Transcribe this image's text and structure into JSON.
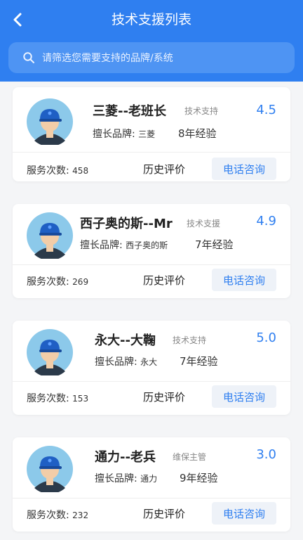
{
  "header": {
    "title": "技术支援列表",
    "search_placeholder": "请筛选您需要支持的品牌/系统"
  },
  "colors": {
    "accent": "#2f7ff0",
    "header_bg": "#2f7ff0"
  },
  "icons": {
    "back": "chevron-left-icon",
    "search": "search-icon",
    "avatar": "technician-avatar-icon"
  },
  "technicians": [
    {
      "name": "三菱--老班长",
      "role": "技术支持",
      "rating": "4.5",
      "brand_label": "擅长品牌:",
      "brand": "三菱",
      "experience": "8年经验",
      "count_label": "服务次数:",
      "count": "458",
      "history_label": "历史评价",
      "call_label": "电话咨询"
    },
    {
      "name": "西子奥的斯--Mr",
      "role": "技术支援",
      "rating": "4.9",
      "brand_label": "擅长品牌:",
      "brand": "西子奥的斯",
      "experience": "7年经验",
      "count_label": "服务次数:",
      "count": "269",
      "history_label": "历史评价",
      "call_label": "电话咨询"
    },
    {
      "name": "永大--大鞠",
      "role": "技术支持",
      "rating": "5.0",
      "brand_label": "擅长品牌:",
      "brand": "永大",
      "experience": "7年经验",
      "count_label": "服务次数:",
      "count": "153",
      "history_label": "历史评价",
      "call_label": "电话咨询"
    },
    {
      "name": "通力--老兵",
      "role": "维保主管",
      "rating": "3.0",
      "brand_label": "擅长品牌:",
      "brand": "通力",
      "experience": "9年经验",
      "count_label": "服务次数:",
      "count": "232",
      "history_label": "历史评价",
      "call_label": "电话咨询"
    }
  ]
}
